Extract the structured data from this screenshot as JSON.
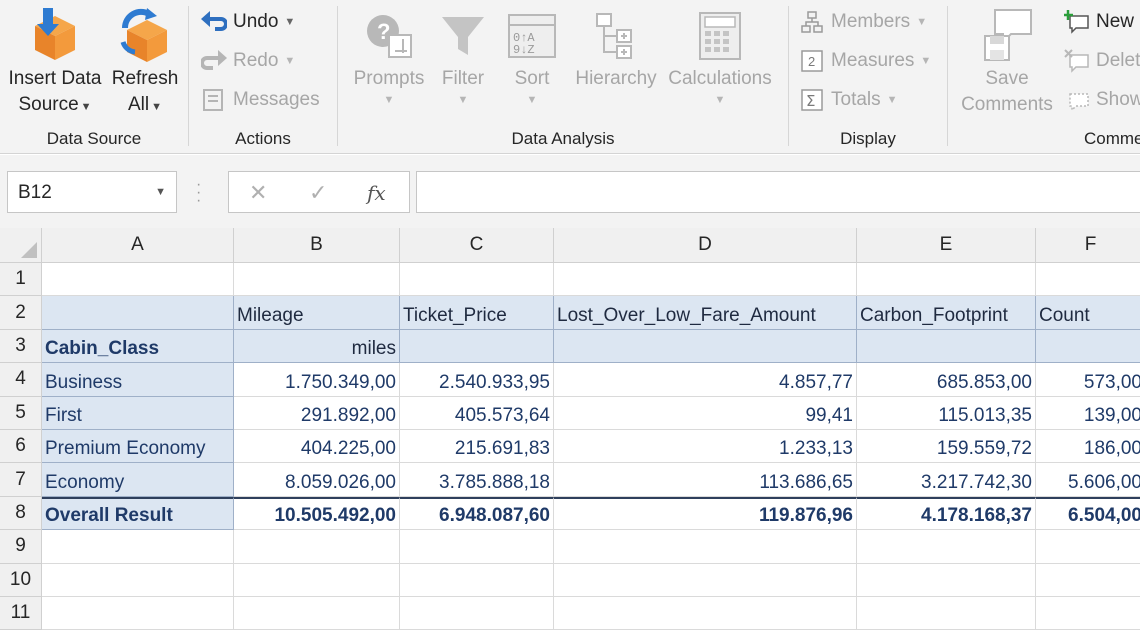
{
  "ribbon": {
    "data_source": {
      "label": "Data Source",
      "insert": {
        "line1": "Insert Data",
        "line2": "Source"
      },
      "refresh": {
        "line1": "Refresh",
        "line2": "All"
      }
    },
    "actions": {
      "label": "Actions",
      "undo": "Undo",
      "redo": "Redo",
      "messages": "Messages"
    },
    "data_analysis": {
      "label": "Data Analysis",
      "prompts": "Prompts",
      "filter": "Filter",
      "sort": "Sort",
      "hierarchy": "Hierarchy",
      "calculations": "Calculations"
    },
    "display": {
      "label": "Display",
      "members": "Members",
      "measures": "Measures",
      "totals": "Totals"
    },
    "comments": {
      "label": "Comme",
      "save_line1": "Save",
      "save_line2": "Comments",
      "new": "New",
      "delete": "Delet",
      "show": "Show"
    }
  },
  "formula_bar": {
    "name_box": "B12",
    "formula": ""
  },
  "grid": {
    "columns": [
      "A",
      "B",
      "C",
      "D",
      "E",
      "F"
    ],
    "rows": [
      "1",
      "2",
      "3",
      "4",
      "5",
      "6",
      "7",
      "8",
      "9",
      "10",
      "11"
    ],
    "measure_headers": [
      "Mileage",
      "Ticket_Price",
      "Lost_Over_Low_Fare_Amount",
      "Carbon_Footprint",
      "Count"
    ],
    "dimension_header": "Cabin_Class",
    "unit_mileage": "miles",
    "data_rows": [
      {
        "label": "Business",
        "values": [
          "1.750.349,00",
          "2.540.933,95",
          "4.857,77",
          "685.853,00",
          "573,00"
        ]
      },
      {
        "label": "First",
        "values": [
          "291.892,00",
          "405.573,64",
          "99,41",
          "115.013,35",
          "139,00"
        ]
      },
      {
        "label": "Premium Economy",
        "values": [
          "404.225,00",
          "215.691,83",
          "1.233,13",
          "159.559,72",
          "186,00"
        ]
      },
      {
        "label": "Economy",
        "values": [
          "8.059.026,00",
          "3.785.888,18",
          "113.686,65",
          "3.217.742,30",
          "5.606,00"
        ]
      }
    ],
    "total": {
      "label": "Overall Result",
      "values": [
        "10.505.492,00",
        "6.948.087,60",
        "119.876,96",
        "4.178.168,37",
        "6.504,00"
      ]
    }
  }
}
